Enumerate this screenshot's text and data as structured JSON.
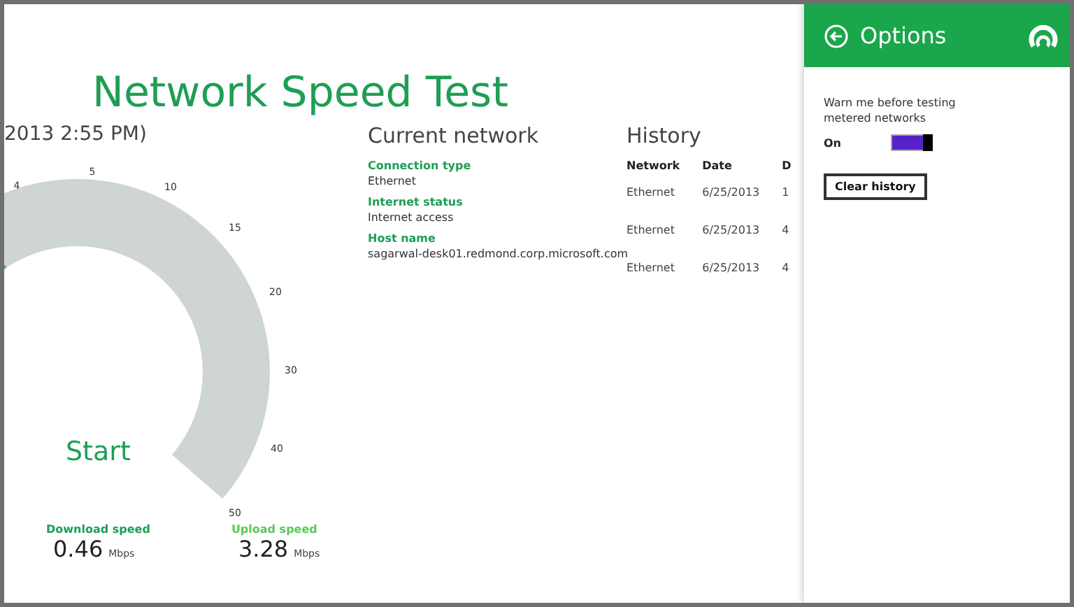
{
  "app": {
    "title": "Network Speed Test",
    "last_test": "2013 2:55 PM)"
  },
  "gauge": {
    "ticks": [
      "4",
      "5",
      "10",
      "15",
      "20",
      "30",
      "40",
      "50"
    ]
  },
  "start_button": "Start",
  "results": [
    {
      "label": "Download speed",
      "value": "0.46",
      "unit": "Mbps",
      "kind": "download"
    },
    {
      "label": "Upload speed",
      "value": "3.28",
      "unit": "Mbps",
      "kind": "upload"
    }
  ],
  "current_network": {
    "heading": "Current network",
    "fields": [
      {
        "label": "Connection type",
        "value": "Ethernet"
      },
      {
        "label": "Internet status",
        "value": "Internet access"
      },
      {
        "label": "Host name",
        "value": "sagarwal-desk01.redmond.corp.microsoft.com"
      }
    ]
  },
  "history": {
    "heading": "History",
    "columns": [
      "Network",
      "Date",
      "D"
    ],
    "rows": [
      [
        "Ethernet",
        "6/25/2013",
        "1"
      ],
      [
        "Ethernet",
        "6/25/2013",
        "4"
      ],
      [
        "Ethernet",
        "6/25/2013",
        "4"
      ]
    ]
  },
  "options": {
    "title": "Options",
    "setting_label": "Warn me before testing metered networks",
    "toggle": {
      "label": "On",
      "on": true
    },
    "clear_button": "Clear history"
  }
}
